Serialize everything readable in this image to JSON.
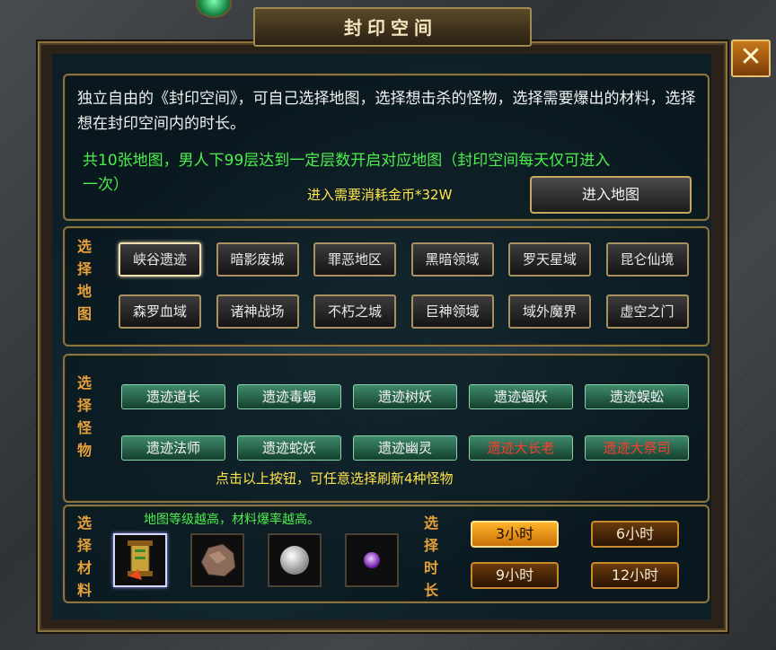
{
  "window": {
    "title": "封印空间",
    "close_label": "✕"
  },
  "intro": {
    "description": "独立自由的《封印空间》，可自己选择地图，选择想击杀的怪物，选择需要爆出的材料，选择想在封印空间内的时长。",
    "note": "共10张地图，男人下99层达到一定层数开启对应地图（封印空间每天仅可进入一次）",
    "cost": "进入需要消耗金币*32W",
    "enter_button": "进入地图"
  },
  "map_section": {
    "label": "选择地图",
    "selected": "峡谷遗迹",
    "maps": [
      "峡谷遗迹",
      "暗影废城",
      "罪恶地区",
      "黑暗领域",
      "罗天星域",
      "昆仑仙境",
      "森罗血域",
      "诸神战场",
      "不朽之城",
      "巨神领域",
      "域外魔界",
      "虚空之门"
    ]
  },
  "monster_section": {
    "label": "选择怪物",
    "monsters": [
      "遗迹道长",
      "遗迹毒蝎",
      "遗迹树妖",
      "遗迹蝠妖",
      "遗迹蜈蚣",
      "遗迹法师",
      "遗迹蛇妖",
      "遗迹幽灵",
      "遗迹大长老",
      "遗迹大祭司"
    ],
    "boss_color": "#ff3b2e",
    "hint": "点击以上按钮，可任意选择刷新4种怪物"
  },
  "material_section": {
    "label": "选择材料",
    "note": "地图等级越高，材料爆率越高。",
    "materials": [
      "scroll-item-icon",
      "ore-item-icon",
      "pearl-item-icon",
      "purple-gem-icon"
    ]
  },
  "time_section": {
    "label": "选择时长",
    "selected": "3小时",
    "options": [
      "3小时",
      "6小时",
      "9小时",
      "12小时"
    ]
  }
}
